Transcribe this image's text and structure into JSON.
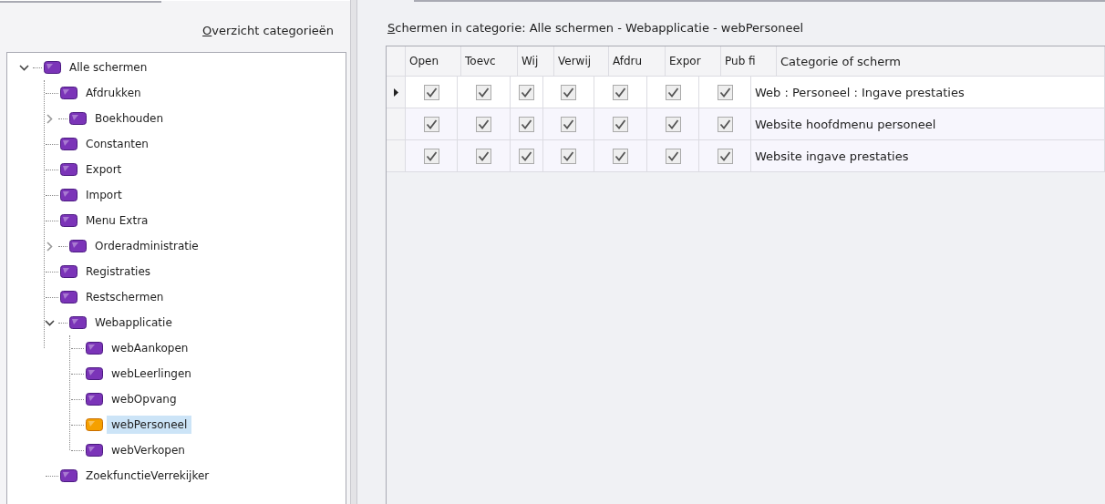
{
  "left_panel": {
    "title": "Overzicht categorieën",
    "title_mnemonic_underlined": true,
    "tree": [
      {
        "label": "Alle schermen",
        "expanded": true,
        "selected": false,
        "children": [
          {
            "label": "Afdrukken",
            "selected": false
          },
          {
            "label": "Boekhouden",
            "expanded": false,
            "selected": false
          },
          {
            "label": "Constanten",
            "selected": false
          },
          {
            "label": "Export",
            "selected": false
          },
          {
            "label": "Import",
            "selected": false
          },
          {
            "label": "Menu Extra",
            "selected": false
          },
          {
            "label": "Orderadministratie",
            "expanded": false,
            "selected": false
          },
          {
            "label": "Registraties",
            "selected": false
          },
          {
            "label": "Restschermen",
            "selected": false
          },
          {
            "label": "Webapplicatie",
            "expanded": true,
            "selected": false,
            "children": [
              {
                "label": "webAankopen",
                "selected": false
              },
              {
                "label": "webLeerlingen",
                "selected": false
              },
              {
                "label": "webOpvang",
                "selected": false
              },
              {
                "label": "webPersoneel",
                "selected": true
              },
              {
                "label": "webVerkopen",
                "selected": false
              }
            ]
          },
          {
            "label": "ZoekfunctieVerrekijker",
            "selected": false
          }
        ]
      }
    ]
  },
  "right_panel": {
    "title": "Schermen in categorie: Alle schermen - Webapplicatie - webPersoneel",
    "title_mnemonic_underlined": true,
    "table": {
      "columns": [
        "Open",
        "Toevc",
        "Wij",
        "Verwij",
        "Afdru",
        "Expor",
        "Pub fi",
        "Categorie of scherm"
      ],
      "rows": [
        {
          "current": true,
          "checks": [
            true,
            true,
            true,
            true,
            true,
            true,
            true
          ],
          "name": "Web : Personeel : Ingave prestaties"
        },
        {
          "current": false,
          "checks": [
            true,
            true,
            true,
            true,
            true,
            true,
            true
          ],
          "name": "Website hoofdmenu personeel"
        },
        {
          "current": false,
          "checks": [
            true,
            true,
            true,
            true,
            true,
            true,
            true
          ],
          "name": "Website ingave prestaties"
        }
      ]
    }
  }
}
